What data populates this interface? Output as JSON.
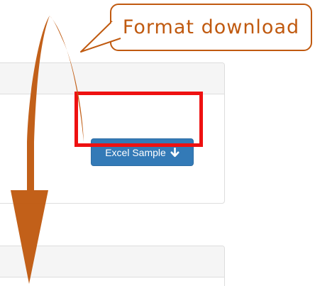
{
  "callout": {
    "text": "Format download"
  },
  "panels": {
    "top": {
      "button": {
        "label": "Excel Sample",
        "icon": "arrow-down-icon"
      }
    }
  },
  "colors": {
    "button_bg": "#337ab7",
    "highlight": "#ee1111",
    "annotation": "#c05a10"
  }
}
